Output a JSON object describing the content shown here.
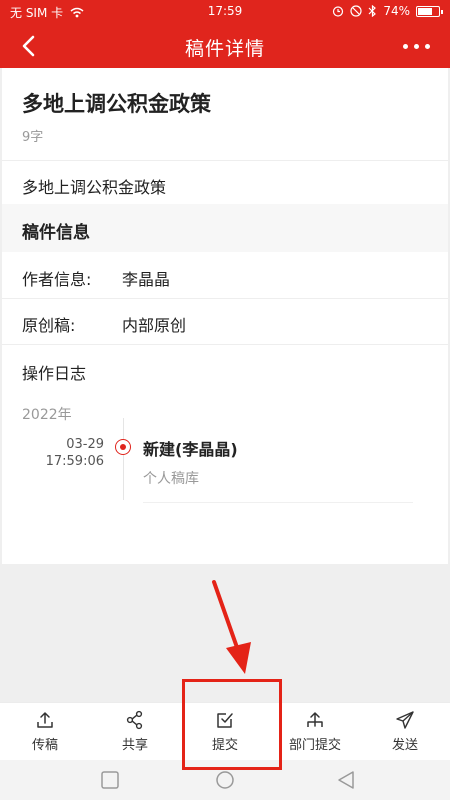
{
  "status_bar": {
    "carrier": "无 SIM 卡",
    "time": "17:59",
    "battery": "74%",
    "battery_level": 0.74
  },
  "navbar": {
    "title": "稿件详情"
  },
  "doc": {
    "title": "多地上调公积金政策",
    "word_count": "9字",
    "summary": "多地上调公积金政策"
  },
  "manuscript_info": {
    "section_title": "稿件信息",
    "author_label": "作者信息:",
    "author_value": "李晶晶",
    "original_label": "原创稿:",
    "original_value": "内部原创"
  },
  "log": {
    "title": "操作日志",
    "year": "2022年",
    "entries": [
      {
        "date": "03-29",
        "time": "17:59:06",
        "action": "新建(李晶晶)",
        "location": "个人稿库"
      }
    ]
  },
  "toolbar": {
    "items": [
      {
        "label": "传稿",
        "icon": "upload-icon"
      },
      {
        "label": "共享",
        "icon": "share-icon"
      },
      {
        "label": "提交",
        "icon": "submit-check-icon"
      },
      {
        "label": "部门提交",
        "icon": "department-submit-icon"
      },
      {
        "label": "发送",
        "icon": "send-icon"
      }
    ]
  },
  "colors": {
    "primary": "#e0251d",
    "annotation": "#e42317"
  }
}
